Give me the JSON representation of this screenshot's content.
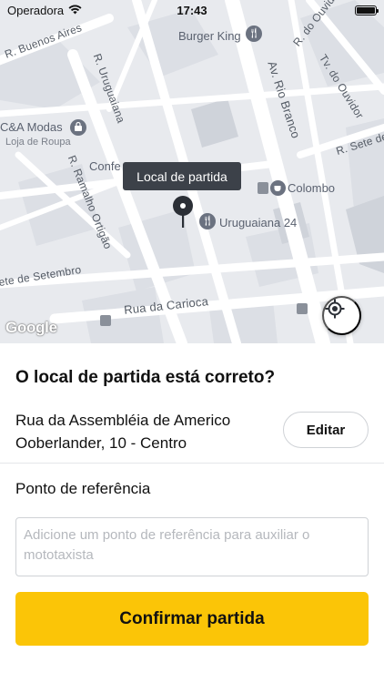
{
  "status_bar": {
    "carrier": "Operadora",
    "time": "17:43"
  },
  "map": {
    "streets": {
      "buenos_aires": "R. Buenos Aires",
      "uruguaiana": "R. Uruguaiana",
      "ramalho_ortigao": "R. Ramalho Ortigão",
      "rio_branco": "Av. Rio Branco",
      "do_ouvidor": "R. do Ouvidor",
      "tv_do_ouvidor": "Tv. do Ouvidor",
      "sete_de_setembro_right": "R. Sete de Se",
      "sete_de_setembro_left": "ete de Setembro",
      "carioca": "Rua da Carioca"
    },
    "pois": {
      "burger_king": "Burger King",
      "ca_modas": "C&A Modas",
      "ca_modas_sub": "Loja de Roupa",
      "confeitaria": "Confe",
      "colombo": "Colombo",
      "uruguaiana_24": "Uruguaiana 24"
    },
    "tooltip": "Local de partida",
    "logo": "Google",
    "marker_color": "#2b2f36"
  },
  "sheet": {
    "question": "O local de partida está correto?",
    "address": "Rua da Assembléia de Americo Ooberlander, 10 - Centro",
    "edit_label": "Editar",
    "reference_label": "Ponto de referência",
    "reference_placeholder": "Adicione um ponto de referência para auxiliar o mototaxista",
    "reference_value": "",
    "confirm_label": "Confirmar partida",
    "accent_color": "#fbc507"
  }
}
